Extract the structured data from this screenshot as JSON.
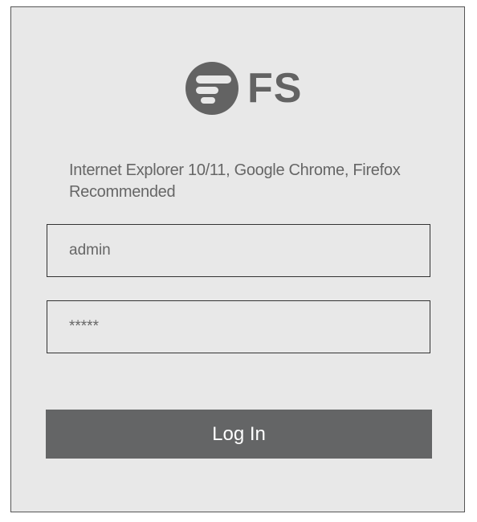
{
  "brand": {
    "logo_icon": "fs-logo-icon",
    "logo_text": "FS"
  },
  "notice": {
    "browsers": "Internet Explorer 10/11, Google Chrome, Firefox Recommended"
  },
  "form": {
    "username_value": "admin",
    "password_value": "*****",
    "login_label": "Log In"
  },
  "colors": {
    "panel_bg": "#e8e8e8",
    "button_bg": "#646566",
    "logo": "#636363"
  }
}
